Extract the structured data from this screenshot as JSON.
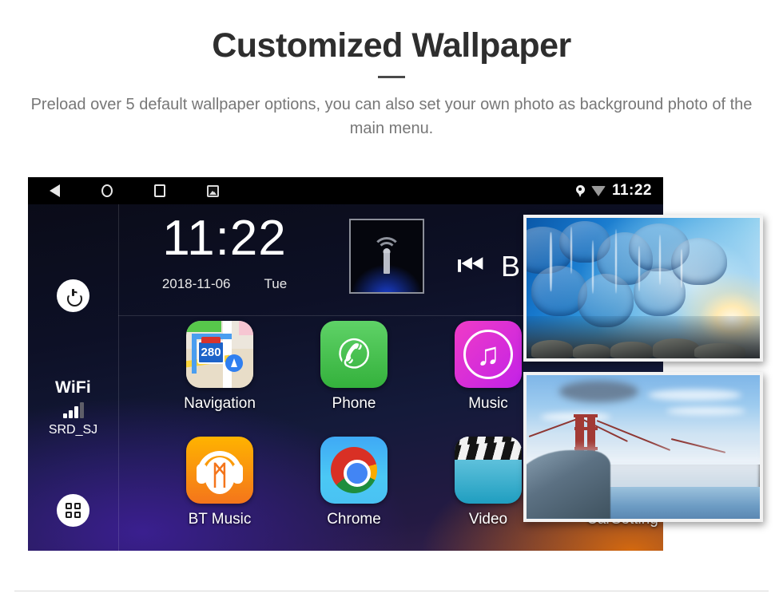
{
  "promo": {
    "title": "Customized Wallpaper",
    "subtitle": "Preload over 5 default wallpaper options, you can also set your own photo as background photo of the main menu."
  },
  "device": {
    "statusbar": {
      "nav": [
        {
          "name": "back-icon",
          "label": "Back"
        },
        {
          "name": "home-icon",
          "label": "Home"
        },
        {
          "name": "recents-icon",
          "label": "Recents"
        },
        {
          "name": "screenshot-icon",
          "label": "Screenshot"
        }
      ],
      "location_icon": "location-pin-icon",
      "wifi_icon": "wifi-icon",
      "time": "11:22"
    },
    "rail": {
      "power_label": "Power",
      "wifi_label": "WiFi",
      "wifi_ssid": "SRD_SJ",
      "wifi_bars_filled": 3,
      "wifi_bars_total": 4,
      "apps_label": "All Apps"
    },
    "clock_widget": {
      "time": "11:22",
      "date": "2018-11-06",
      "weekday": "Tue"
    },
    "media_widget": {
      "art_icon": "radio-tower-icon",
      "prev_icon": "previous-track-icon",
      "prev_glyph": "⏮",
      "track_text": "B"
    },
    "apps": [
      {
        "name": "navigation",
        "label": "Navigation",
        "shield_number": "280"
      },
      {
        "name": "phone",
        "label": "Phone",
        "glyph": "✆"
      },
      {
        "name": "music",
        "label": "Music",
        "glyph": "♫"
      },
      {
        "name": "bt-music",
        "label": "BT Music",
        "glyph": "ᛗ"
      },
      {
        "name": "chrome",
        "label": "Chrome"
      },
      {
        "name": "video",
        "label": "Video"
      },
      {
        "name": "carsetting",
        "label": "CarSetting"
      }
    ]
  },
  "wallpaper_thumbnails": [
    {
      "name": "ice-cave-wallpaper",
      "alt": "Blue ice cave with sunlight"
    },
    {
      "name": "golden-gate-wallpaper",
      "alt": "Golden Gate Bridge in fog"
    }
  ],
  "colors": {
    "title": "#2e2e2e",
    "subtitle": "#777777",
    "statusbar_bg": "#000000",
    "accent_orange": "#f4751b",
    "accent_magenta": "#e8175d",
    "divider": "#d9d9d9"
  }
}
